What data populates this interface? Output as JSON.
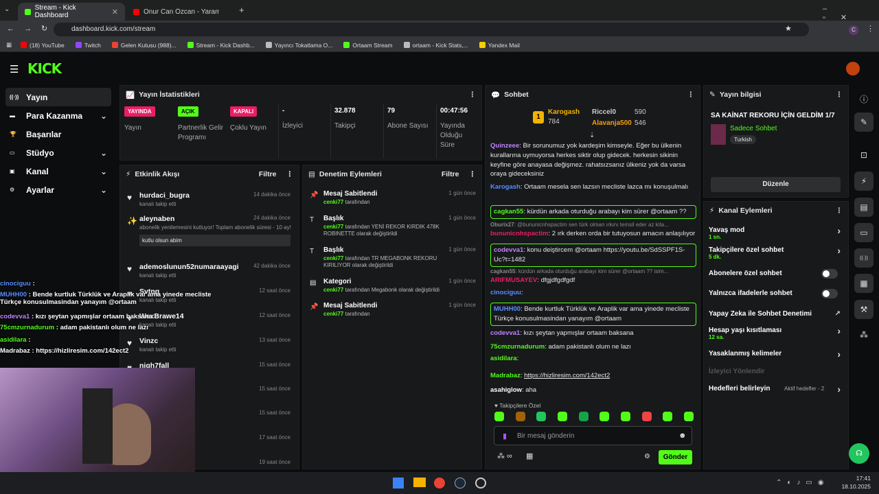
{
  "browser": {
    "tabs": [
      {
        "title": "Stream - Kick Dashboard",
        "active": true
      },
      {
        "title": "Onur Can Özcan - Yaramızda K",
        "active": false
      }
    ],
    "url": "dashboard.kick.com/stream",
    "bookmarks": [
      {
        "label": "(18) YouTube",
        "color": "#ff0000"
      },
      {
        "label": "Twitch",
        "color": "#9146ff"
      },
      {
        "label": "Gelen Kutusu (988)...",
        "color": "#ea4335"
      },
      {
        "label": "Stream - Kick Dashb...",
        "color": "#53fc18"
      },
      {
        "label": "Yayıncı Tokatlama O...",
        "color": "#bbbbbb"
      },
      {
        "label": "Ortaam Stream",
        "color": "#53fc18"
      },
      {
        "label": "ortaam - Kick Stats,...",
        "color": "#bbbbbb"
      },
      {
        "label": "Yandex Mail",
        "color": "#ffcc00"
      }
    ]
  },
  "sidebar": {
    "items": [
      {
        "label": "Yayın",
        "icon": "stream-icon"
      },
      {
        "label": "Para Kazanma",
        "icon": "money-icon"
      },
      {
        "label": "Başarılar",
        "icon": "trophy-icon"
      },
      {
        "label": "Stüdyo",
        "icon": "studio-icon"
      },
      {
        "label": "Kanal",
        "icon": "channel-icon"
      },
      {
        "label": "Ayarlar",
        "icon": "gear-icon"
      }
    ]
  },
  "stats": {
    "title": "Yayın İstatistikleri",
    "cells": [
      {
        "pill": "YAYINDA",
        "pill_color": "#e91e63",
        "label": "Yayın"
      },
      {
        "pill": "AÇIK",
        "pill_color": "#53fc18",
        "label": "Partnerlik Gelir Programı"
      },
      {
        "pill": "KAPALI",
        "pill_color": "#e91e63",
        "label": "Çoklu Yayın"
      },
      {
        "value": "-",
        "label": "İzleyici"
      },
      {
        "value": "32.878",
        "label": "Takipçi"
      },
      {
        "value": "79",
        "label": "Abone Sayısı"
      },
      {
        "value": "00:47:56",
        "label": "Yayında Olduğu Süre"
      }
    ]
  },
  "activity": {
    "title": "Etkinlik Akışı",
    "filter": "Filtre",
    "items": [
      {
        "name": "hurdaci_bugra",
        "sub": "kanalı takip etti",
        "time": "14 dakika önce"
      },
      {
        "name": "aleynaben",
        "sub": "abonelik yenilemesini kutluyor! Toplam abonelik süresi - 10 ay!",
        "time": "24 dakika önce",
        "msg": "kutlu olsun abim"
      },
      {
        "name": "ademoslunun52numaraayagi",
        "sub": "kanalı takip etti",
        "time": "42 dakika önce"
      },
      {
        "name": "Svtng",
        "sub": "kanalı takip etti",
        "time": "12 saat önce"
      },
      {
        "name": "WexBrawe14",
        "sub": "kanalı takip etti",
        "time": "12 saat önce"
      },
      {
        "name": "Vinzc",
        "sub": "kanalı takip etti",
        "time": "13 saat önce"
      },
      {
        "name": "nigh7fall",
        "sub": "",
        "time": "15 saat önce"
      },
      {
        "name": "",
        "sub": "",
        "time": "15 saat önce"
      },
      {
        "name": "",
        "sub": "",
        "time": "15 saat önce"
      },
      {
        "name": "",
        "sub": "",
        "time": "17 saat önce"
      },
      {
        "name": "",
        "sub": "",
        "time": "19 saat önce"
      }
    ]
  },
  "moderation": {
    "title": "Denetim Eylemleri",
    "filter": "Filtre",
    "items": [
      {
        "name": "Mesaj Sabitlendi",
        "user": "cenki77",
        "sub": "tarafından",
        "time": "1 gün önce"
      },
      {
        "name": "Başlık",
        "user": "cenki77",
        "sub": "tarafından YENİ REKOR KIRDIK 478K ROBINETTE olarak değiştirildi",
        "time": "1 gün önce"
      },
      {
        "name": "Başlık",
        "user": "cenki77",
        "sub": "tarafından TR MEGABONK REKORU KIRILIYOR olarak değiştirildi",
        "time": "1 gün önce"
      },
      {
        "name": "Kategori",
        "user": "cenki77",
        "sub": "tarafından Megabonk olarak değiştirildi",
        "time": "1 gün önce"
      },
      {
        "name": "Mesaj Sabitlendi",
        "user": "cenki77",
        "sub": "tarafından",
        "time": "1 gün önce"
      }
    ]
  },
  "chat": {
    "title": "Sohbet",
    "top": [
      {
        "rank": "1",
        "name": "Karogash",
        "val": "784"
      },
      {
        "name": "Riccel0",
        "val": "590"
      },
      {
        "name": "Alavanja500",
        "val": "546"
      }
    ],
    "messages": [
      {
        "user": "Quinzeee",
        "color": "#c084fc",
        "text": "Bir sorunumuz yok kardeşim kimseyle. Eğer bu ülkenin kurallarına uymuyorsa herkes siktir olup gidecek. herkesin sikinin keyfine göre anayasa değişmez. rahatsızsanız ülkeniz yok da varsa oraya gideceksiniz"
      },
      {
        "user": "Karogash",
        "color": "#5b8cff",
        "text": "Ortaam mesela sen lazsın mecliste lazca mı konuşulmalı"
      },
      {
        "user": "cagkan55",
        "color": "#53fc18",
        "text": "kürdün arkada oturduğu arabayı kim sürer @ortaam ??",
        "boxed": true
      },
      {
        "user": "Oburix27",
        "color": "#888888",
        "text": "@bununicnhspactim sen türk olman ırkını temsil eder az kita..."
      },
      {
        "user": "bununicnhspactim",
        "color": "#e91e63",
        "text": "2 ırk derken orda bir tutuyosun amacın anlaşılıyor"
      },
      {
        "user": "codevva1",
        "color": "#c084fc",
        "text": "konu deiştircem @ortaam https://youtu.be/SdSSPF1S-Uc?t=1482",
        "boxed": true
      },
      {
        "user": "cagkan55",
        "color": "#888888",
        "text": "kürdün arkada oturduğu arabayı kim sürer @ortaam ?? isim..."
      },
      {
        "user": "ARIFMUSAYEV",
        "color": "#e91e63",
        "text": "dfgjdfgdfgdf"
      },
      {
        "user": "cinociguu",
        "color": "#5b8cff",
        "text": ""
      },
      {
        "user": "MUHH00",
        "color": "#5b8cff",
        "text": "Bende kurtluk Türklük ve Araplik var ama yinede mecliste Türkçe konusulmasindan yanayım @ortaam",
        "boxed": true
      },
      {
        "user": "codevva1",
        "color": "#c084fc",
        "text": "kızı şeytan yapmışlar ortaam baksana"
      },
      {
        "user": "75cmzurnadurum",
        "color": "#53fc18",
        "text": "adam pakistanlı olum ne lazı"
      },
      {
        "user": "asidilara",
        "color": "#53fc18",
        "text": ""
      },
      {
        "user": "Madrabaz",
        "color": "#53fc18",
        "text": "https://hizliresim.com/142ect2"
      },
      {
        "user": "asahiglow",
        "color": "#ffffff",
        "text": "aha"
      }
    ],
    "followers_only": "Takipçilere Özel",
    "placeholder": "Bir mesaj gönderin",
    "send": "Gönder"
  },
  "info": {
    "title": "Yayın bilgisi",
    "stream_title": "SA KAİNAT REKORU İÇİN GELDİM 1/7",
    "category": "Sadece Sohbet",
    "tag": "Turkish",
    "edit": "Düzenle"
  },
  "channel_actions": {
    "title": "Kanal Eylemleri",
    "items": [
      {
        "label": "Yavaş mod",
        "sub": "1 sn.",
        "ctrl": "arrow"
      },
      {
        "label": "Takipçilere özel sohbet",
        "sub": "5 dk.",
        "ctrl": "arrow"
      },
      {
        "label": "Abonelere özel sohbet",
        "sub": "",
        "ctrl": "toggle"
      },
      {
        "label": "Yalnızca ifadelerle sohbet",
        "sub": "",
        "ctrl": "toggle"
      },
      {
        "label": "Yapay Zeka ile Sohbet Denetimi",
        "sub": "",
        "ctrl": "ext"
      },
      {
        "label": "Hesap yaşı kısıtlaması",
        "sub": "12 sa.",
        "ctrl": "arrow"
      },
      {
        "label": "Yasaklanmış kelimeler",
        "sub": "",
        "ctrl": "arrow"
      },
      {
        "label": "İzleyici Yönlendir",
        "sub": "",
        "ctrl": "none",
        "disabled": true
      },
      {
        "label": "Hedefleri belirleyin",
        "sub": "",
        "ctrl": "arrow",
        "extra": "Aktif hedefler - 2"
      }
    ]
  },
  "overlay": [
    {
      "user": "cinociguu",
      "color": "#5b8cff",
      "text": ":"
    },
    {
      "user": "MUHH00",
      "color": "#5b8cff",
      "text": ": Bende kurtluk Türklük ve Araplik var ama yinede mecliste Türkçe konusulmasindan yanayım @ortaam"
    },
    {
      "user": "codevva1",
      "color": "#c084fc",
      "text": ": kızı şeytan yapmışlar ortaam baksana"
    },
    {
      "user": "75cmzurnadurum",
      "color": "#53fc18",
      "text": ": adam pakistanlı olum ne lazı"
    },
    {
      "user": "asidilara",
      "color": "#53fc18",
      "text": ":"
    },
    {
      "user": "Madrabaz",
      "color": "#ffffff",
      "text": ": https://hizliresim.com/142ect2"
    }
  ],
  "taskbar": {
    "time": "17:41",
    "date": "18.10.2025"
  }
}
